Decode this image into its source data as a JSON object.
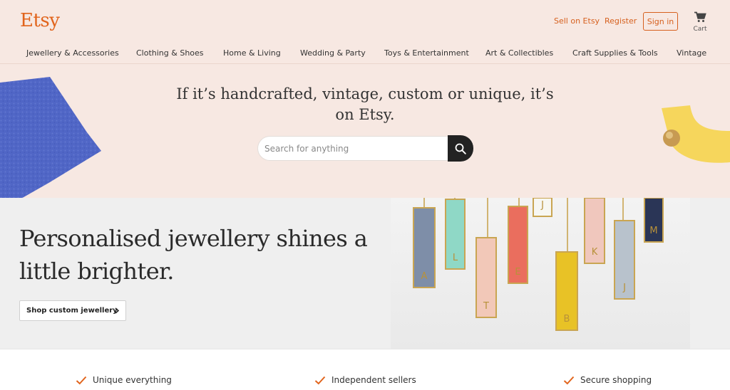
{
  "header": {
    "logo": "Etsy",
    "sell_link": "Sell on Etsy",
    "register_link": "Register",
    "signin_button": "Sign in",
    "cart_label": "Cart"
  },
  "nav": {
    "items": [
      "Jewellery & Accessories",
      "Clothing & Shoes",
      "Home & Living",
      "Wedding & Party",
      "Toys & Entertainment",
      "Art & Collectibles",
      "Craft Supplies & Tools",
      "Vintage"
    ]
  },
  "hero": {
    "title": "If it’s handcrafted, vintage, custom or unique, it’s on Etsy.",
    "search_placeholder": "Search for anything"
  },
  "banner": {
    "title": "Personalised jewellery shines a little brighter.",
    "button": "Shop custom jewellery",
    "pendants": [
      {
        "letter": "A",
        "color": "#7e8ea8"
      },
      {
        "letter": "L",
        "color": "#8fd8c6"
      },
      {
        "letter": "T",
        "color": "#f2c8b8"
      },
      {
        "letter": "E",
        "color": "#ea6e5e"
      },
      {
        "letter": "J",
        "color": "#f7f7f2"
      },
      {
        "letter": "B",
        "color": "#e8c226"
      },
      {
        "letter": "K",
        "color": "#f0c7bd"
      },
      {
        "letter": "J",
        "color": "#b8c2cc"
      },
      {
        "letter": "M",
        "color": "#2a3556"
      }
    ]
  },
  "features": {
    "items": [
      "Unique everything",
      "Independent sellers",
      "Secure shopping"
    ]
  },
  "colors": {
    "brand": "#e1641c",
    "hero_background": "#f7e8e2",
    "banner_background": "#efefef",
    "search_button": "#222222"
  }
}
